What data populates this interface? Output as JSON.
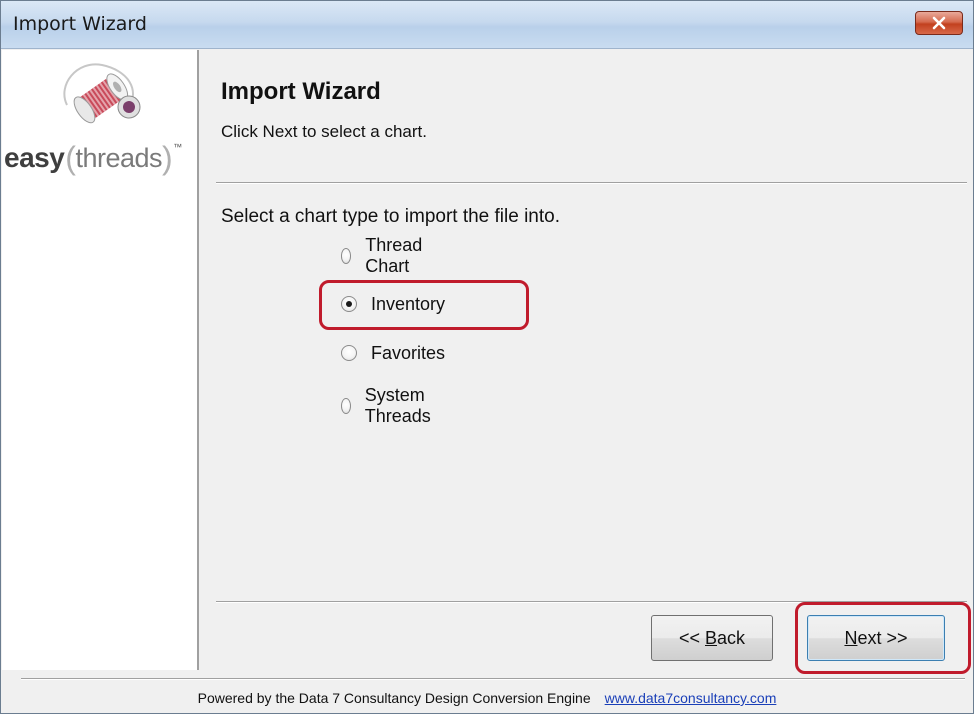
{
  "window": {
    "title": "Import Wizard"
  },
  "logo": {
    "word1": "easy",
    "word2": "threads",
    "trademark": "™",
    "paren_open": "(",
    "paren_close": ")"
  },
  "header": {
    "title": "Import Wizard",
    "subtitle": "Click Next to select a chart."
  },
  "content": {
    "prompt": "Select a chart type to import the file into.",
    "options": [
      {
        "label": "Thread Chart",
        "checked": false
      },
      {
        "label": "Inventory",
        "checked": true
      },
      {
        "label": "Favorites",
        "checked": false
      },
      {
        "label": "System Threads",
        "checked": false
      }
    ]
  },
  "buttons": {
    "back_prefix": "<< ",
    "back_mnemonic": "B",
    "back_rest": "ack",
    "next_mnemonic": "N",
    "next_rest": "ext >>"
  },
  "footer": {
    "text": "Powered by the Data 7 Consultancy Design Conversion Engine",
    "link": "www.data7consultancy.com"
  },
  "colors": {
    "highlight": "#c01b2c",
    "link": "#1a3fb8",
    "dialog_bg": "#f0f0f0"
  }
}
